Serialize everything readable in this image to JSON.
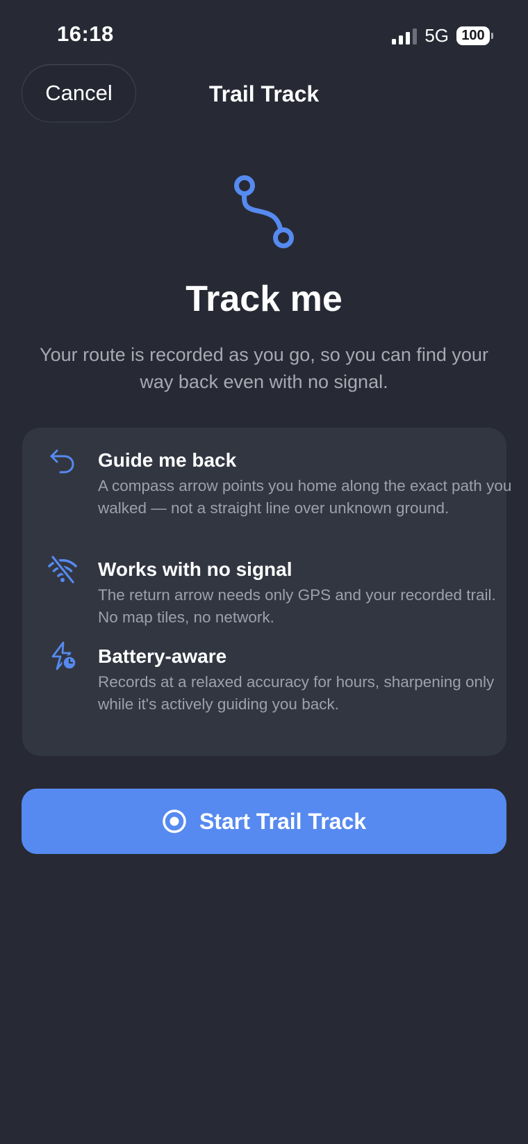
{
  "status_bar": {
    "time": "16:18",
    "network": "5G",
    "battery": "100"
  },
  "nav": {
    "cancel_label": "Cancel",
    "title": "Trail Track"
  },
  "hero": {
    "icon": "route-icon",
    "title": "Track me",
    "subtitle": "Your route is recorded as you go, so you can find your way back even with no signal."
  },
  "features": [
    {
      "icon": "return-arrow-icon",
      "title": "Guide me back",
      "description": "A compass arrow points you home along the exact path you walked — not a straight line over unknown ground."
    },
    {
      "icon": "no-wifi-icon",
      "title": "Works with no signal",
      "description": "The return arrow needs only GPS and your recorded trail. No map tiles, no network."
    },
    {
      "icon": "battery-bolt-icon",
      "title": "Battery-aware",
      "description": "Records at a relaxed accuracy for hours, sharpening only while it's actively guiding you back."
    }
  ],
  "start_button": {
    "icon": "record-icon",
    "label": "Start Trail Track"
  },
  "colors": {
    "background": "#272a34",
    "card": "#323641",
    "accent": "#568af0",
    "secondary_text": "#a7a9b3"
  }
}
